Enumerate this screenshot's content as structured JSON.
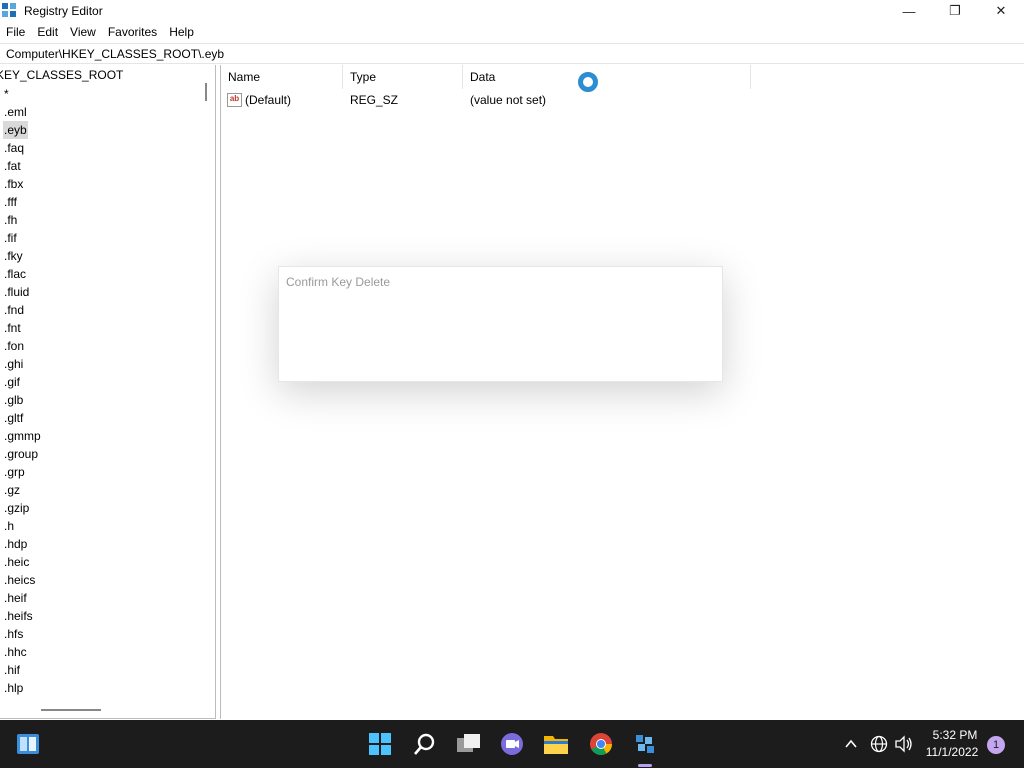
{
  "window": {
    "title": "Registry Editor",
    "minimize_glyph": "—",
    "maximize_glyph": "❐",
    "close_glyph": "✕"
  },
  "menu": [
    "File",
    "Edit",
    "View",
    "Favorites",
    "Help"
  ],
  "address": "Computer\\HKEY_CLASSES_ROOT\\.eyb",
  "tree": {
    "root_label": "KEY_CLASSES_ROOT",
    "items": [
      "*",
      ".eml",
      ".eyb",
      ".faq",
      ".fat",
      ".fbx",
      ".fff",
      ".fh",
      ".fif",
      ".fky",
      ".flac",
      ".fluid",
      ".fnd",
      ".fnt",
      ".fon",
      ".ghi",
      ".gif",
      ".glb",
      ".gltf",
      ".gmmp",
      ".group",
      ".grp",
      ".gz",
      ".gzip",
      ".h",
      ".hdp",
      ".heic",
      ".heics",
      ".heif",
      ".heifs",
      ".hfs",
      ".hhc",
      ".hif",
      ".hlp"
    ],
    "selected": ".eyb"
  },
  "list": {
    "columns": {
      "name": "Name",
      "type": "Type",
      "data": "Data"
    },
    "rows": [
      {
        "name": "(Default)",
        "type": "REG_SZ",
        "data": "(value not set)",
        "icon": "ab-string-icon",
        "icon_text": "ab"
      }
    ]
  },
  "dialog": {
    "title": "Confirm Key Delete"
  },
  "taskbar": {
    "time": "5:32 PM",
    "date": "11/1/2022",
    "notification_count": "1",
    "accent": "#b7a1f0"
  }
}
